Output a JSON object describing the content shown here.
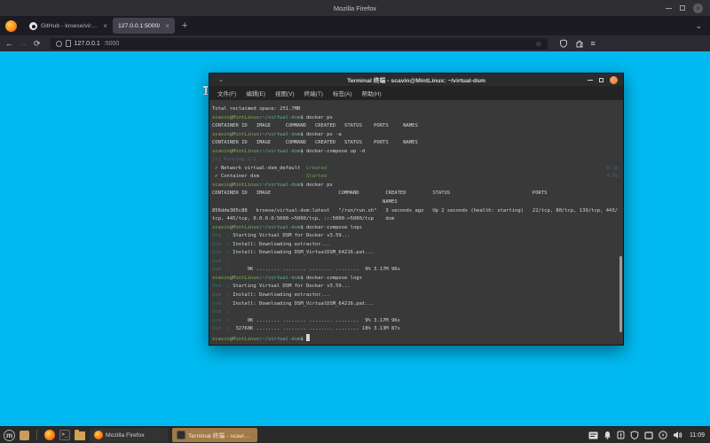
{
  "browser": {
    "window_title": "Mozilla Firefox",
    "tabs": [
      {
        "label": "GitHub - kroese/virtual-dsm",
        "close": "×"
      },
      {
        "label": "127.0.0.1:5000/",
        "close": "×"
      }
    ],
    "new_tab_label": "+",
    "url": {
      "host": "127.0.0.1",
      "port": ":5000"
    },
    "nav": {
      "back": "←",
      "forward": "→",
      "reload": "⟳",
      "star": "☆",
      "menu": "≡",
      "list_tabs": "⌄"
    },
    "page_color": "#00b9f0"
  },
  "terminal": {
    "title": "Terminal 终端 - scavin@MintLinux: ~/virtual-dsm",
    "chevron": "⌄",
    "menus": [
      "文件(F)",
      "编辑(E)",
      "视图(V)",
      "终端(T)",
      "标签(A)",
      "帮助(H)"
    ],
    "colors": {
      "background": "#393939",
      "foreground": "#d6d6d6",
      "green": "#83b15c",
      "path_teal": "#68b2a4",
      "dim_teal": "#2f6f68",
      "dim_blue": "#47637f"
    },
    "lines": [
      {
        "segs": [
          [
            "Total reclaimed space: 251.7MB",
            "f"
          ]
        ]
      },
      {
        "segs": [
          [
            "scavin@MintLinux",
            "g"
          ],
          [
            ":",
            "f"
          ],
          [
            "~/virtual-dsm",
            "p"
          ],
          [
            "$ ",
            "f"
          ],
          [
            "docker ps",
            "f"
          ]
        ]
      },
      {
        "segs": [
          [
            "CONTAINER ID   IMAGE     COMMAND   CREATED   STATUS    PORTS     NAMES",
            "f"
          ]
        ]
      },
      {
        "segs": [
          [
            "scavin@MintLinux",
            "g"
          ],
          [
            ":",
            "f"
          ],
          [
            "~/virtual-dsm",
            "p"
          ],
          [
            "$ ",
            "f"
          ],
          [
            "docker ps -a",
            "f"
          ]
        ]
      },
      {
        "segs": [
          [
            "CONTAINER ID   IMAGE     COMMAND   CREATED   STATUS    PORTS     NAMES",
            "f"
          ]
        ]
      },
      {
        "segs": [
          [
            "scavin@MintLinux",
            "g"
          ],
          [
            ":",
            "f"
          ],
          [
            "~/virtual-dsm",
            "p"
          ],
          [
            "$ ",
            "f"
          ],
          [
            "docker-compose up -d",
            "f"
          ]
        ]
      },
      {
        "segs": [
          [
            "[+] Running 2/2",
            "b"
          ]
        ]
      },
      {
        "segs": [
          [
            " ✔ ",
            "g"
          ],
          [
            "Network virtual-dsm_default  ",
            "f"
          ],
          [
            "Created",
            "h"
          ]
        ],
        "right": [
          "0.1s",
          "b"
        ]
      },
      {
        "segs": [
          [
            " ✔ ",
            "g"
          ],
          [
            "Container dsm                ",
            "f"
          ],
          [
            "Started",
            "h"
          ]
        ],
        "right": [
          "0.0s",
          "b"
        ]
      },
      {
        "segs": [
          [
            "scavin@MintLinux",
            "g"
          ],
          [
            ":",
            "f"
          ],
          [
            "~/virtual-dsm",
            "p"
          ],
          [
            "$ ",
            "f"
          ],
          [
            "docker ps",
            "f"
          ]
        ]
      },
      {
        "segs": [
          [
            "CONTAINER ID   IMAGE                       COMMAND         CREATED         STATUS                            PORTS",
            "f"
          ]
        ]
      },
      {
        "segs": [
          [
            "                                                          NAMES",
            "f"
          ]
        ]
      },
      {
        "segs": [
          [
            "856dde305c88   kroese/virtual-dsm:latest   \"/run/run.sh\"   3 seconds ago   Up 2 seconds (health: starting)   22/tcp, 80/tcp, 139/tcp, 443/",
            "f"
          ]
        ]
      },
      {
        "segs": [
          [
            "tcp, 445/tcp, 0.0.0.0:5000->5000/tcp, :::5000->5000/tcp    dsm",
            "f"
          ]
        ]
      },
      {
        "segs": [
          [
            "scavin@MintLinux",
            "g"
          ],
          [
            ":",
            "f"
          ],
          [
            "~/virtual-dsm",
            "p"
          ],
          [
            "$ ",
            "f"
          ],
          [
            "docker-compose logs",
            "f"
          ]
        ]
      },
      {
        "segs": [
          [
            "dsm  | ",
            "d"
          ],
          [
            "Starting Virtual DSM for Docker v3.59...",
            "f"
          ]
        ]
      },
      {
        "segs": [
          [
            "dsm  | ",
            "d"
          ],
          [
            "Install: Downloading extractor...",
            "f"
          ]
        ]
      },
      {
        "segs": [
          [
            "dsm  | ",
            "d"
          ],
          [
            "Install: Downloading DSM_VirtualDSM_64216.pat...",
            "f"
          ]
        ]
      },
      {
        "segs": [
          [
            "dsm  |",
            "d"
          ]
        ]
      },
      {
        "segs": [
          [
            "dsm  | ",
            "d"
          ],
          [
            "     0K ........ ........ ........ ........  9% 3.17M 96s",
            "f"
          ]
        ]
      },
      {
        "segs": [
          [
            "scavin@MintLinux",
            "g"
          ],
          [
            ":",
            "f"
          ],
          [
            "~/virtual-dsm",
            "p"
          ],
          [
            "$ ",
            "f"
          ],
          [
            "docker-compose logs",
            "f"
          ]
        ]
      },
      {
        "segs": [
          [
            "dsm  | ",
            "d"
          ],
          [
            "Starting Virtual DSM for Docker v3.59...",
            "f"
          ]
        ]
      },
      {
        "segs": [
          [
            "dsm  | ",
            "d"
          ],
          [
            "Install: Downloading extractor...",
            "f"
          ]
        ]
      },
      {
        "segs": [
          [
            "dsm  | ",
            "d"
          ],
          [
            "Install: Downloading DSM_VirtualDSM_64216.pat...",
            "f"
          ]
        ]
      },
      {
        "segs": [
          [
            "dsm  |",
            "d"
          ]
        ]
      },
      {
        "segs": [
          [
            "dsm  | ",
            "d"
          ],
          [
            "     0K ........ ........ ........ ........  9% 3.17M 96s",
            "f"
          ]
        ]
      },
      {
        "segs": [
          [
            "dsm  | ",
            "d"
          ],
          [
            " 32768K ........ ........ ........ ........ 18% 3.13M 87s",
            "f"
          ]
        ]
      },
      {
        "segs": [
          [
            "scavin@MintLinux",
            "g"
          ],
          [
            ":",
            "f"
          ],
          [
            "~/virtual-dsm",
            "p"
          ],
          [
            "$ ",
            "f"
          ]
        ],
        "cursor": true
      }
    ]
  },
  "taskbar": {
    "menu_label": "m",
    "terminal_glyph": ">_",
    "windows": [
      {
        "label": "Mozilla Firefox"
      },
      {
        "label": "Terminal 终端 - scavin@Mi..."
      }
    ],
    "clock": "11:09"
  }
}
